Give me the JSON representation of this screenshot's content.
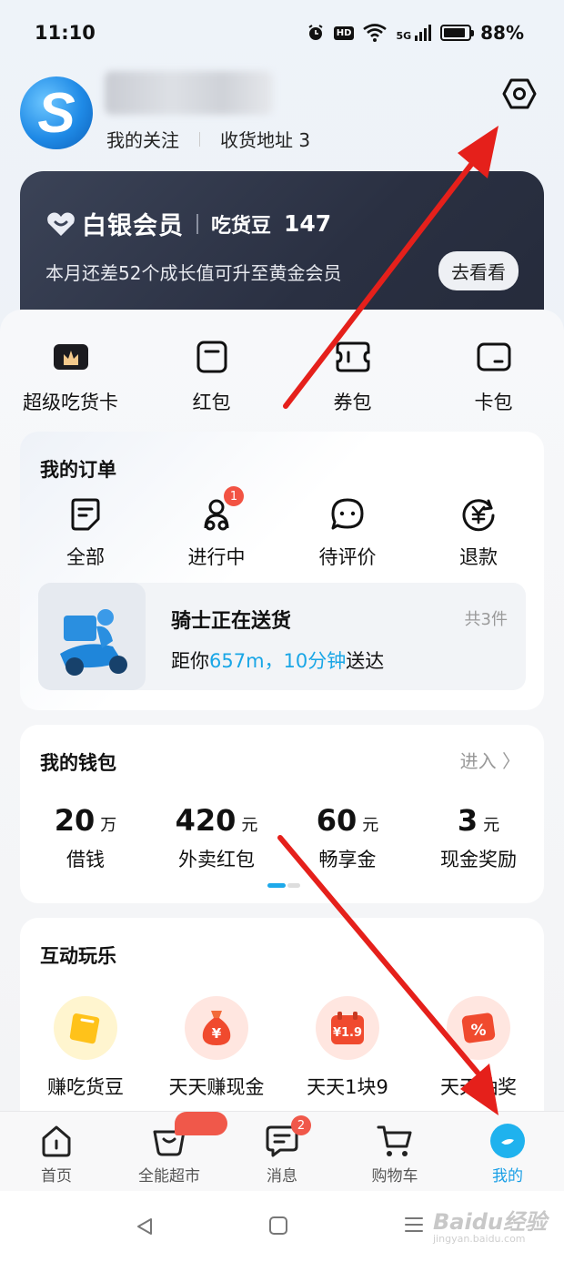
{
  "status_bar": {
    "time": "11:10",
    "hd": "HD",
    "network": "5G",
    "battery": "88%"
  },
  "profile": {
    "avatar_letter": "S",
    "follow_label": "我的关注",
    "address_label": "收货地址 3"
  },
  "member": {
    "level": "白银会员",
    "beans_label": "吃货豆",
    "beans_count": "147",
    "progress_text": "本月还差52个成长值可升至黄金会员",
    "button": "去看看"
  },
  "quick": [
    {
      "label": "超级吃货卡",
      "icon": "crown-card-icon"
    },
    {
      "label": "红包",
      "icon": "red-packet-icon"
    },
    {
      "label": "券包",
      "icon": "coupon-icon"
    },
    {
      "label": "卡包",
      "icon": "card-wallet-icon"
    }
  ],
  "orders": {
    "title": "我的订单",
    "items": [
      {
        "label": "全部",
        "icon": "document-icon"
      },
      {
        "label": "进行中",
        "icon": "rider-icon",
        "badge": "1"
      },
      {
        "label": "待评价",
        "icon": "chat-bubble-icon"
      },
      {
        "label": "退款",
        "icon": "yuan-refund-icon"
      }
    ],
    "delivery": {
      "title": "骑士正在送货",
      "count": "共3件",
      "prefix": "距你",
      "distance": "657m，10分钟",
      "suffix": "送达"
    }
  },
  "wallet": {
    "title": "我的钱包",
    "enter": "进入 〉",
    "items": [
      {
        "value": "20",
        "unit": "万",
        "label": "借钱"
      },
      {
        "value": "420",
        "unit": "元",
        "label": "外卖红包"
      },
      {
        "value": "60",
        "unit": "元",
        "label": "畅享金"
      },
      {
        "value": "3",
        "unit": "元",
        "label": "现金奖励"
      }
    ]
  },
  "fun": {
    "title": "互动玩乐",
    "items": [
      {
        "label": "赚吃货豆",
        "icon": "bean-icon",
        "bg": "#fff6d6"
      },
      {
        "label": "天天赚现金",
        "icon": "money-bag-icon",
        "bg": "#ffe9e4"
      },
      {
        "label": "天天1块9",
        "icon": "calendar-price-icon",
        "bg": "#ffe9e4",
        "badge_text": "¥1.9"
      },
      {
        "label": "天天抽奖",
        "icon": "lottery-ticket-icon",
        "bg": "#ffe9e4",
        "badge_text": "%"
      }
    ]
  },
  "tabs": [
    {
      "label": "首页",
      "icon": "home-icon"
    },
    {
      "label": "全能超市",
      "icon": "basket-icon"
    },
    {
      "label": "消息",
      "icon": "message-icon",
      "badge": "2"
    },
    {
      "label": "购物车",
      "icon": "cart-icon"
    },
    {
      "label": "我的",
      "icon": "profile-icon",
      "active": true
    }
  ],
  "watermark": {
    "text": "Baidu经验",
    "sub": "jingyan.baidu.com"
  },
  "colors": {
    "accent": "#1a9fe6",
    "badge": "#f0584a",
    "member_card": "#2a3042",
    "arrow": "#e5201b"
  }
}
